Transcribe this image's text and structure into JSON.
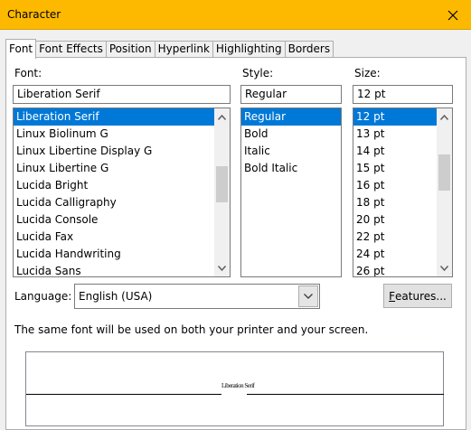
{
  "window": {
    "title": "Character"
  },
  "tabs": [
    "Font",
    "Font Effects",
    "Position",
    "Hyperlink",
    "Highlighting",
    "Borders"
  ],
  "font": {
    "label": "Font:",
    "value": "Liberation Serif",
    "items": [
      "Liberation Serif",
      "Linux Biolinum G",
      "Linux Libertine Display G",
      "Linux Libertine G",
      "Lucida Bright",
      "Lucida Calligraphy",
      "Lucida Console",
      "Lucida Fax",
      "Lucida Handwriting",
      "Lucida Sans"
    ],
    "scroll_position": 0.42
  },
  "style": {
    "label": "Style:",
    "value": "Regular",
    "items": [
      "Regular",
      "Bold",
      "Italic",
      "Bold Italic"
    ]
  },
  "size": {
    "label": "Size:",
    "value": "12 pt",
    "items": [
      "12 pt",
      "13 pt",
      "14 pt",
      "15 pt",
      "16 pt",
      "18 pt",
      "20 pt",
      "22 pt",
      "24 pt",
      "26 pt"
    ],
    "scroll_position": 0.3
  },
  "language": {
    "label": "Language:",
    "value": "English (USA)"
  },
  "features_button": {
    "underlined": "F",
    "rest": "eatures..."
  },
  "info_text": "The same font will be used on both your printer and your screen.",
  "preview": {
    "sample": "Liberation Serif"
  },
  "colors": {
    "titlebar": "#fdb900",
    "selection": "#0078d7"
  }
}
